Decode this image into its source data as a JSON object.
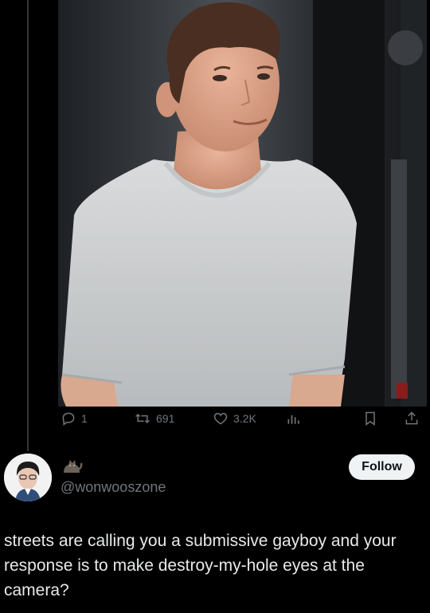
{
  "tweet": {
    "reply_count": "1",
    "retweet_count": "691",
    "like_count": "3.2K"
  },
  "quote": {
    "display_name_emoji": "🐈‍⬛",
    "handle": "@wonwooszone",
    "follow_label": "Follow",
    "text": "streets are calling you a submissive gayboy and your response is to make destroy-my-hole eyes at the camera?"
  },
  "colors": {
    "background": "#000000",
    "muted": "#71767b",
    "text": "#e7e9ea",
    "follow_bg": "#eff3f4"
  },
  "icons": [
    "reply-icon",
    "retweet-icon",
    "like-icon",
    "views-icon",
    "bookmark-icon",
    "share-icon",
    "cat-emoji"
  ]
}
